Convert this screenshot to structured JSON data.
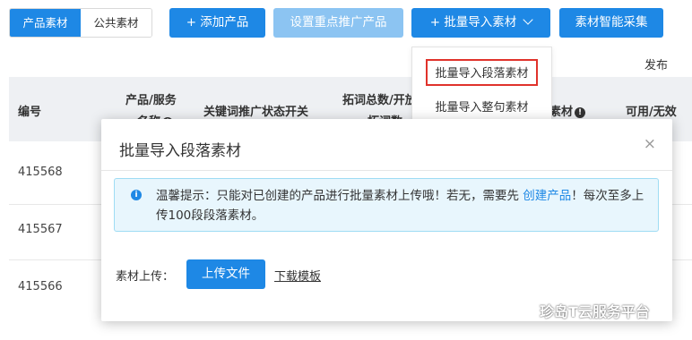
{
  "toolbar": {
    "tab_product_material": "产品素材",
    "tab_public_material": "公共素材",
    "add_product": "+ 添加产品",
    "set_key_promotion": "设置重点推广产品",
    "batch_import": "+ 批量导入素材",
    "smart_collect": "素材智能采集"
  },
  "dropdown": {
    "item_paragraph": "批量导入段落素材",
    "item_sentence": "批量导入整句素材"
  },
  "publish_label": "发布",
  "table": {
    "col_id": "编号",
    "col_product_line1": "产品/服务",
    "col_product_line2": "名称",
    "col_keyword_switch": "关键词推广状态开关",
    "col_expand_line1": "拓词总数/开放",
    "col_expand_line2": "拓词数",
    "col_material": "素材",
    "col_available": "可用/无效",
    "rows": [
      {
        "id": "415568"
      },
      {
        "id": "415567"
      },
      {
        "id": "415566"
      }
    ]
  },
  "modal": {
    "title": "批量导入段落素材",
    "close": "×",
    "alert_prefix": "温馨提示：只能对已创建的产品进行批量素材上传哦！若无，需要先 ",
    "alert_link": "创建产品",
    "alert_suffix": "！每次至多上传100段段落素材。",
    "upload_label": "素材上传：",
    "upload_button": "上传文件",
    "download_template": "下载模板"
  },
  "watermark": {
    "text": "珍岛T云服务平台"
  }
}
